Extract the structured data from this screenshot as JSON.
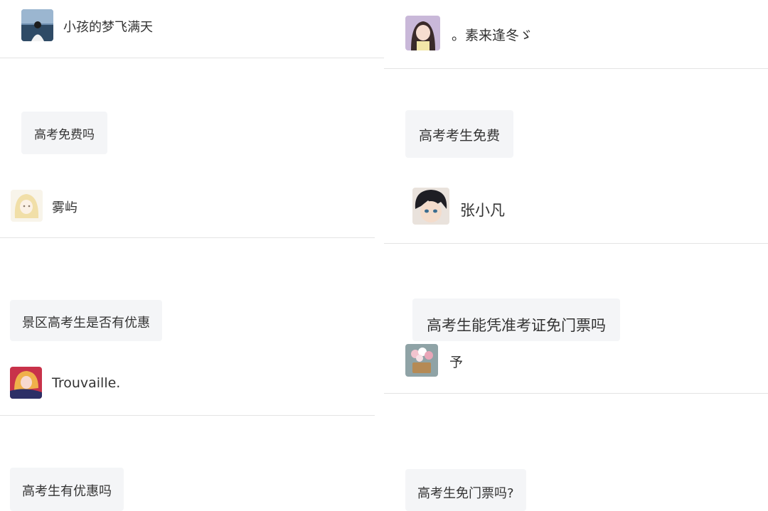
{
  "posts": [
    {
      "username": "小孩的梦飞满天",
      "question": "高考免费吗",
      "avatar_icon": "avatar-icon-seaside-person"
    },
    {
      "username": "。素来逢冬ゞ",
      "question": "高考考生免费",
      "avatar_icon": "avatar-icon-anime-girl"
    },
    {
      "username": "雾屿",
      "question": "景区高考生是否有优惠",
      "avatar_icon": "avatar-icon-sketch-girl"
    },
    {
      "username": "张小凡",
      "question": "高考生能凭准考证免门票吗",
      "avatar_icon": "avatar-icon-anime-boy"
    },
    {
      "username": "Trouvaille.",
      "question": "高考生有优惠吗",
      "avatar_icon": "avatar-icon-anime-pink"
    },
    {
      "username": "予",
      "question": "高考生免门票吗?",
      "avatar_icon": "avatar-icon-flower-basket"
    }
  ],
  "colors": {
    "divider": "#e4e4e4",
    "bubble_bg": "#f4f5f7",
    "text": "#333333"
  }
}
